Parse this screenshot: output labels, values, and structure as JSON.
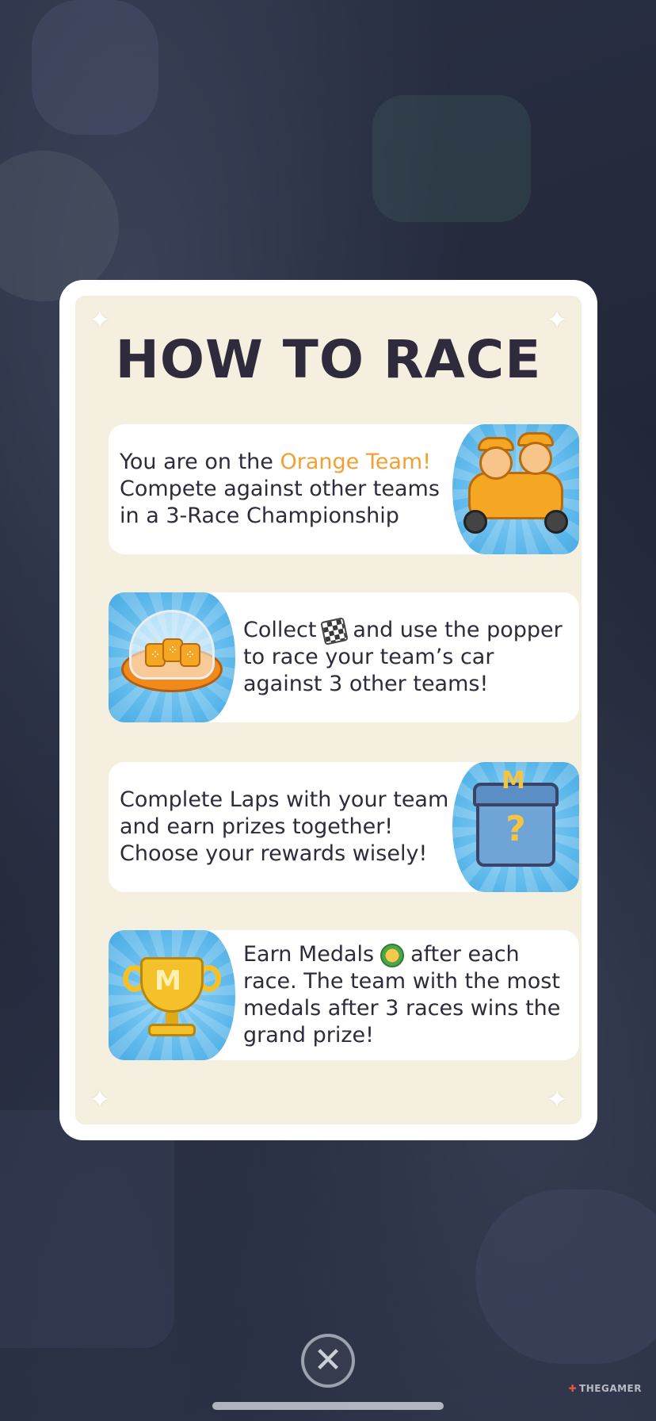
{
  "modal": {
    "title": "HOW TO RACE",
    "rows": [
      {
        "text_before": "You are on the ",
        "highlight": "Orange Team!",
        "text_after": " Compete against other teams in a 3-Race Championship",
        "icon": "race-car-team-icon"
      },
      {
        "text_before": "Collect",
        "inline_icon": "checkered-flag-icon",
        "text_after": "and use the popper to race your team’s car against 3 other teams!",
        "icon": "dice-popper-icon"
      },
      {
        "text": "Complete Laps with your team and earn prizes together! Choose your rewards wisely!",
        "icon": "mystery-chest-icon"
      },
      {
        "text_before": "Earn Medals",
        "inline_icon": "medal-icon",
        "text_after": "after each race. The team with the most medals after 3 races wins the grand prize!",
        "icon": "trophy-icon"
      }
    ]
  },
  "close_icon": "close-x-icon",
  "watermark": "THEGAMER",
  "colors": {
    "highlight": "#f2a032",
    "panel": "#f4efdf",
    "text": "#2f2a3c",
    "art_blue": "#5bb7ea"
  }
}
